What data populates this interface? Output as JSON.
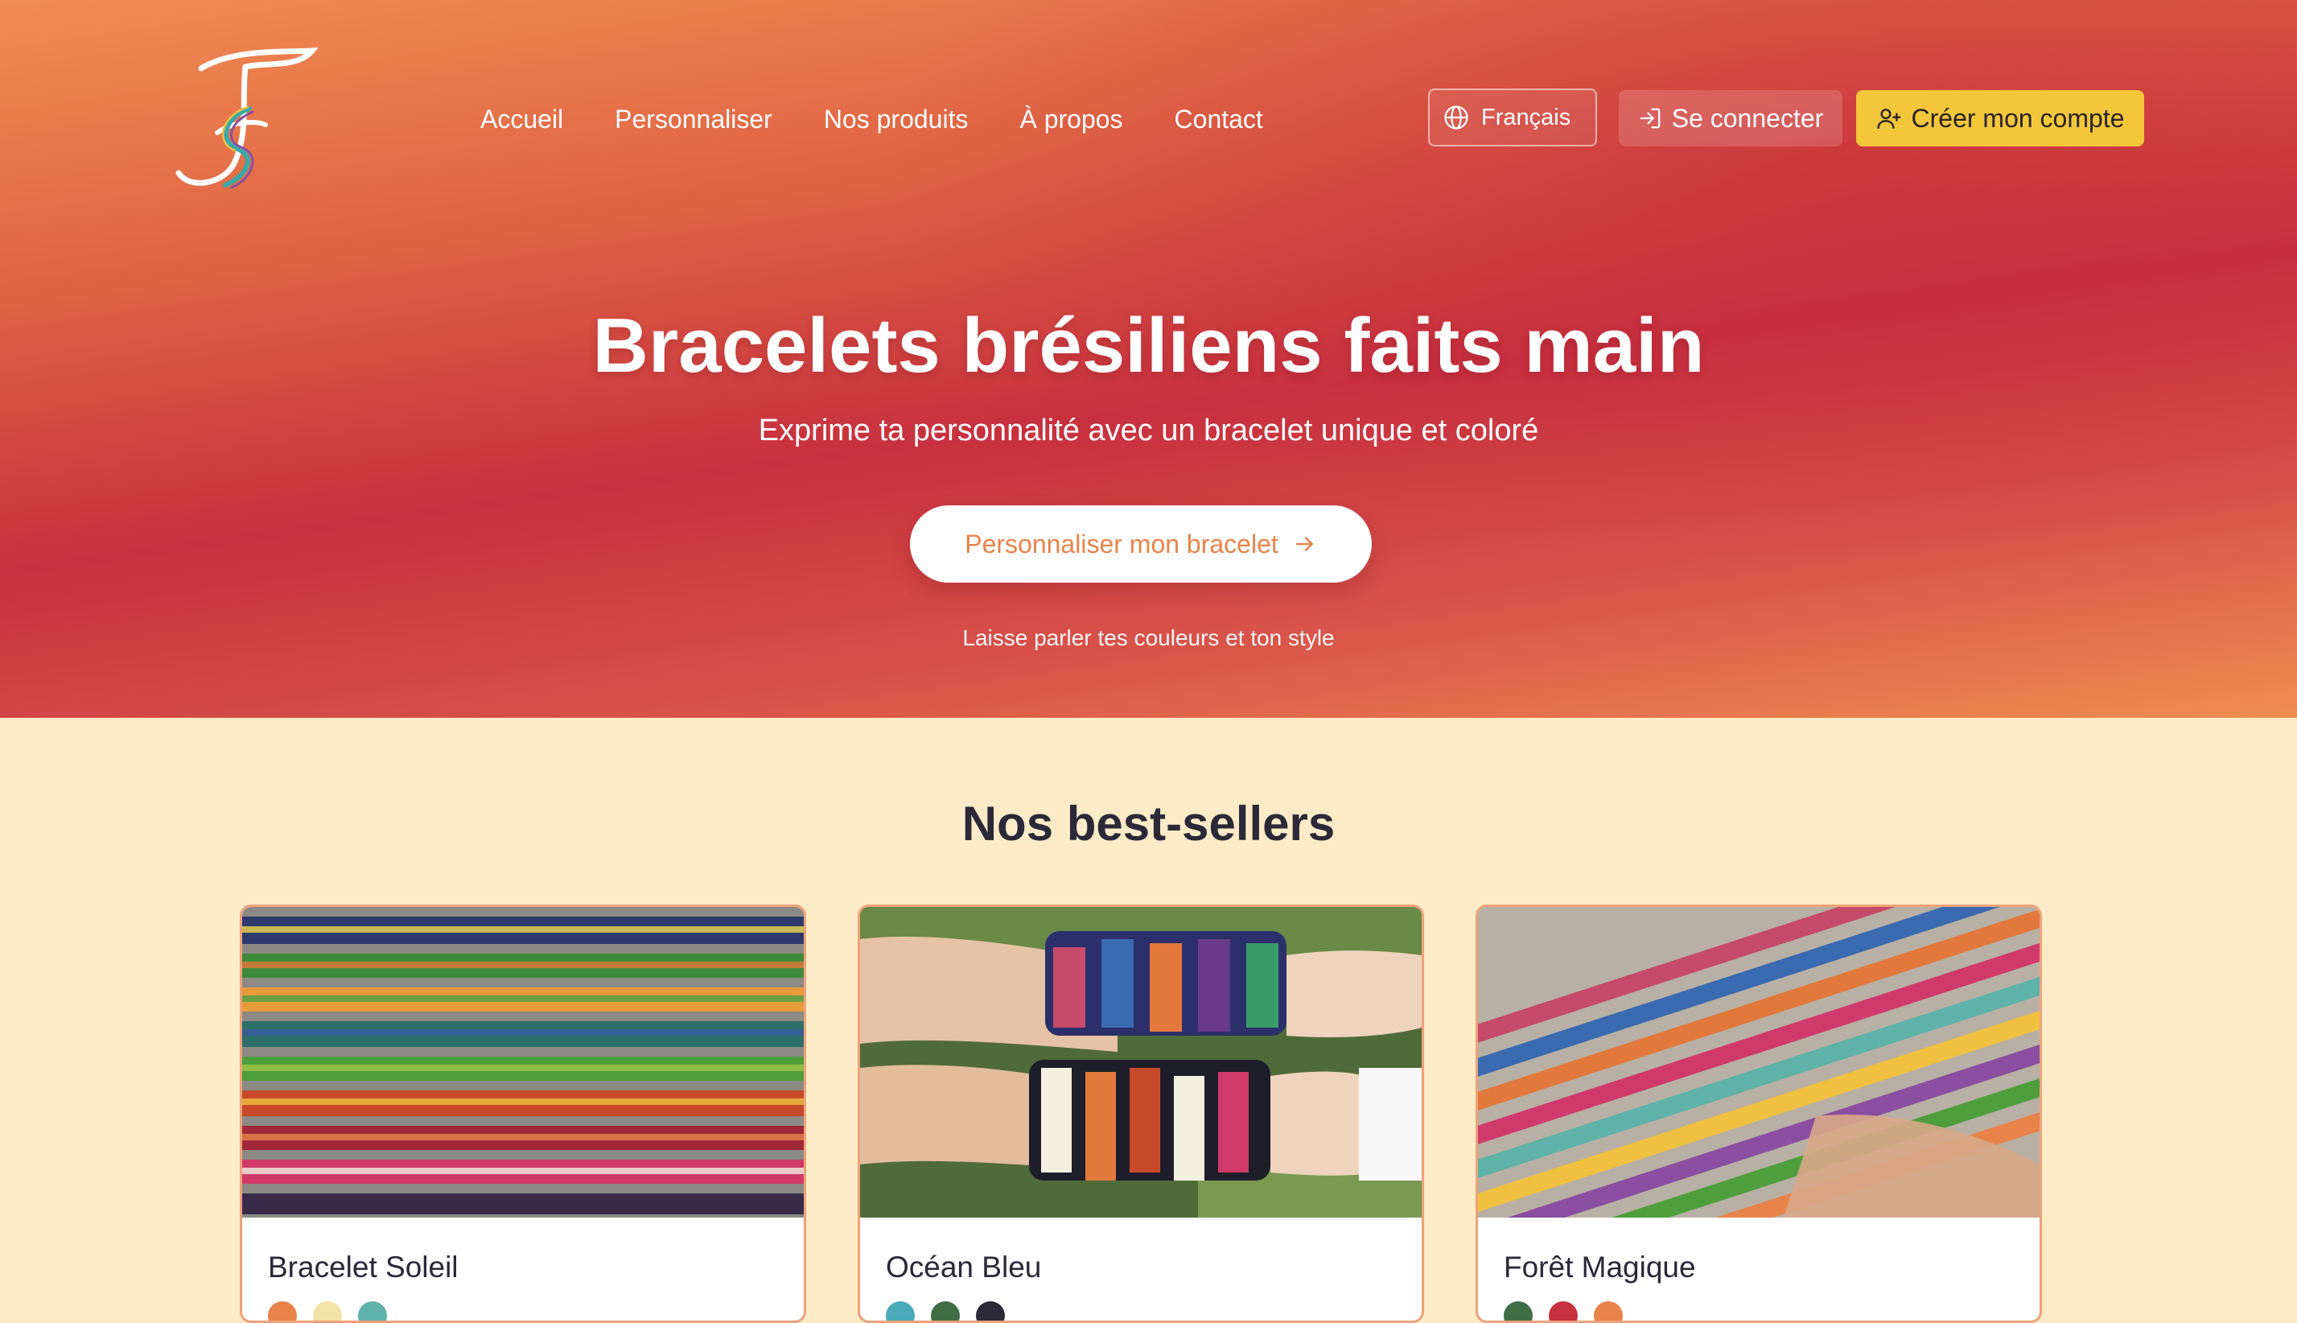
{
  "brand": {
    "logo_letter": "F"
  },
  "nav": [
    {
      "label": "Accueil"
    },
    {
      "label": "Personnaliser"
    },
    {
      "label": "Nos produits"
    },
    {
      "label": "À propos"
    },
    {
      "label": "Contact"
    }
  ],
  "header_actions": {
    "language": "Français",
    "login": "Se connecter",
    "signup": "Créer mon compte"
  },
  "hero": {
    "title": "Bracelets brésiliens faits main",
    "subtitle": "Exprime ta personnalité avec un bracelet unique et coloré",
    "cta": "Personnaliser mon bracelet",
    "tagline": "Laisse parler tes couleurs et ton style"
  },
  "bestsellers": {
    "title": "Nos best-sellers",
    "products": [
      {
        "name": "Bracelet Soleil",
        "colors": [
          "#e8834a",
          "#f2e4a6",
          "#5fb2a8"
        ]
      },
      {
        "name": "Océan Bleu",
        "colors": [
          "#4aa9b6",
          "#3f6e45",
          "#2b2838"
        ]
      },
      {
        "name": "Forêt Magique",
        "colors": [
          "#3f6e45",
          "#c7303e",
          "#e8834a"
        ]
      }
    ]
  },
  "theme": {
    "accent": "#e8834a",
    "brand_red": "#c7303e",
    "signup_yellow": "#f4c63a",
    "cream": "#fcebc6"
  }
}
